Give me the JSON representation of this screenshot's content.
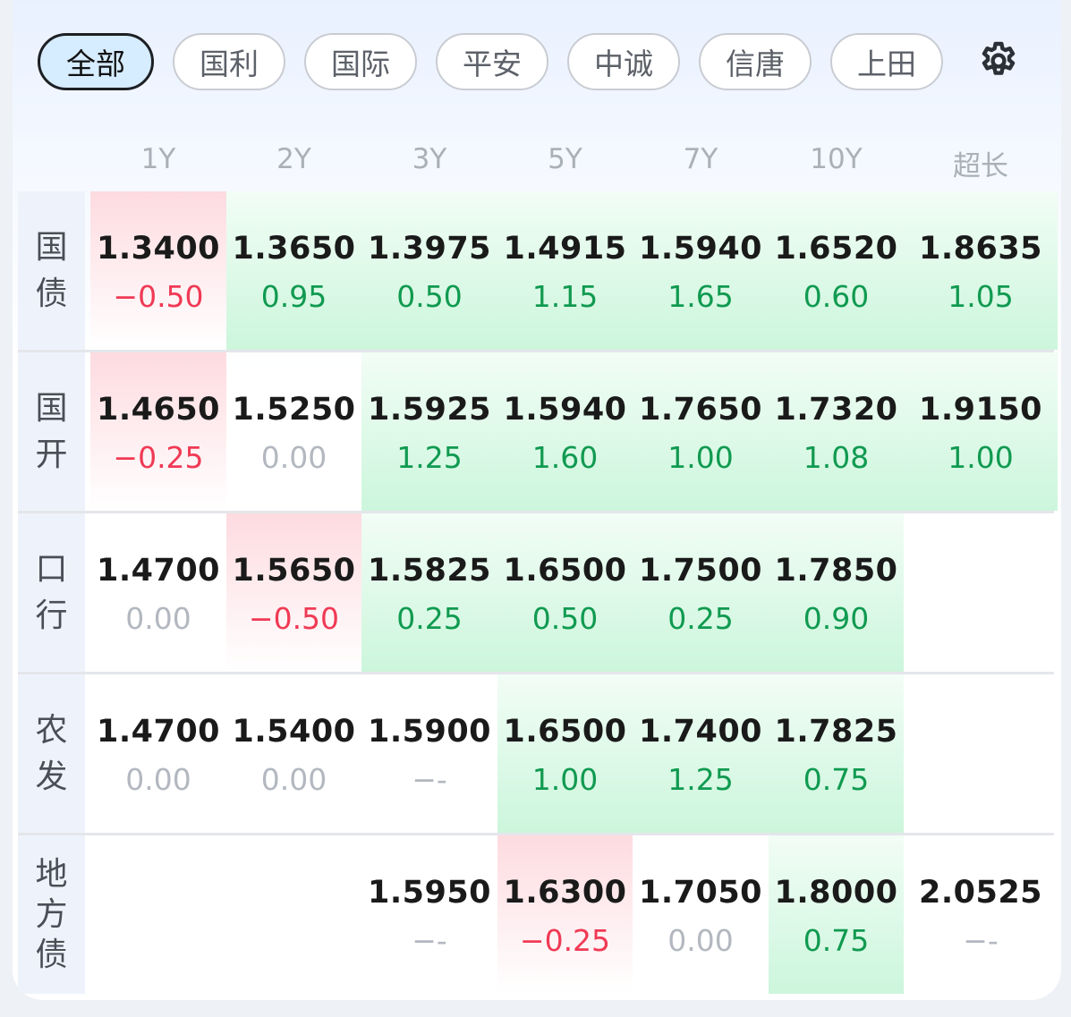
{
  "tabs": [
    {
      "label": "全部",
      "active": true
    },
    {
      "label": "国利",
      "active": false
    },
    {
      "label": "国际",
      "active": false
    },
    {
      "label": "平安",
      "active": false
    },
    {
      "label": "中诚",
      "active": false
    },
    {
      "label": "信唐",
      "active": false
    },
    {
      "label": "上田",
      "active": false
    }
  ],
  "settings_icon": "gear-icon",
  "columns": [
    "1Y",
    "2Y",
    "3Y",
    "5Y",
    "7Y",
    "10Y",
    "超长"
  ],
  "colors": {
    "up": "#109a50",
    "down": "#f03a55",
    "flat": "#b3b8c0",
    "up_bg": "#ccf6dc",
    "down_bg": "#fddbe0"
  },
  "rows": [
    {
      "label": "国债",
      "cells": [
        {
          "value": "1.3400",
          "change": "-0.50",
          "trend": "down"
        },
        {
          "value": "1.3650",
          "change": "0.95",
          "trend": "up"
        },
        {
          "value": "1.3975",
          "change": "0.50",
          "trend": "up"
        },
        {
          "value": "1.4915",
          "change": "1.15",
          "trend": "up"
        },
        {
          "value": "1.5940",
          "change": "1.65",
          "trend": "up"
        },
        {
          "value": "1.6520",
          "change": "0.60",
          "trend": "up"
        },
        {
          "value": "1.8635",
          "change": "1.05",
          "trend": "up"
        }
      ]
    },
    {
      "label": "国开",
      "cells": [
        {
          "value": "1.4650",
          "change": "-0.25",
          "trend": "down"
        },
        {
          "value": "1.5250",
          "change": "0.00",
          "trend": "flat"
        },
        {
          "value": "1.5925",
          "change": "1.25",
          "trend": "up"
        },
        {
          "value": "1.5940",
          "change": "1.60",
          "trend": "up"
        },
        {
          "value": "1.7650",
          "change": "1.00",
          "trend": "up"
        },
        {
          "value": "1.7320",
          "change": "1.08",
          "trend": "up"
        },
        {
          "value": "1.9150",
          "change": "1.00",
          "trend": "up"
        }
      ]
    },
    {
      "label": "口行",
      "cells": [
        {
          "value": "1.4700",
          "change": "0.00",
          "trend": "flat"
        },
        {
          "value": "1.5650",
          "change": "-0.50",
          "trend": "down"
        },
        {
          "value": "1.5825",
          "change": "0.25",
          "trend": "up"
        },
        {
          "value": "1.6500",
          "change": "0.50",
          "trend": "up"
        },
        {
          "value": "1.7500",
          "change": "0.25",
          "trend": "up"
        },
        {
          "value": "1.7850",
          "change": "0.90",
          "trend": "up"
        },
        null
      ]
    },
    {
      "label": "农发",
      "cells": [
        {
          "value": "1.4700",
          "change": "0.00",
          "trend": "flat"
        },
        {
          "value": "1.5400",
          "change": "0.00",
          "trend": "flat"
        },
        {
          "value": "1.5900",
          "change": "--",
          "trend": "flat"
        },
        {
          "value": "1.6500",
          "change": "1.00",
          "trend": "up"
        },
        {
          "value": "1.7400",
          "change": "1.25",
          "trend": "up"
        },
        {
          "value": "1.7825",
          "change": "0.75",
          "trend": "up"
        },
        null
      ]
    },
    {
      "label": "地方债",
      "cells": [
        null,
        null,
        {
          "value": "1.5950",
          "change": "--",
          "trend": "flat"
        },
        {
          "value": "1.6300",
          "change": "-0.25",
          "trend": "down"
        },
        {
          "value": "1.7050",
          "change": "0.00",
          "trend": "flat"
        },
        {
          "value": "1.8000",
          "change": "0.75",
          "trend": "up"
        },
        {
          "value": "2.0525",
          "change": "--",
          "trend": "flat"
        }
      ]
    }
  ]
}
